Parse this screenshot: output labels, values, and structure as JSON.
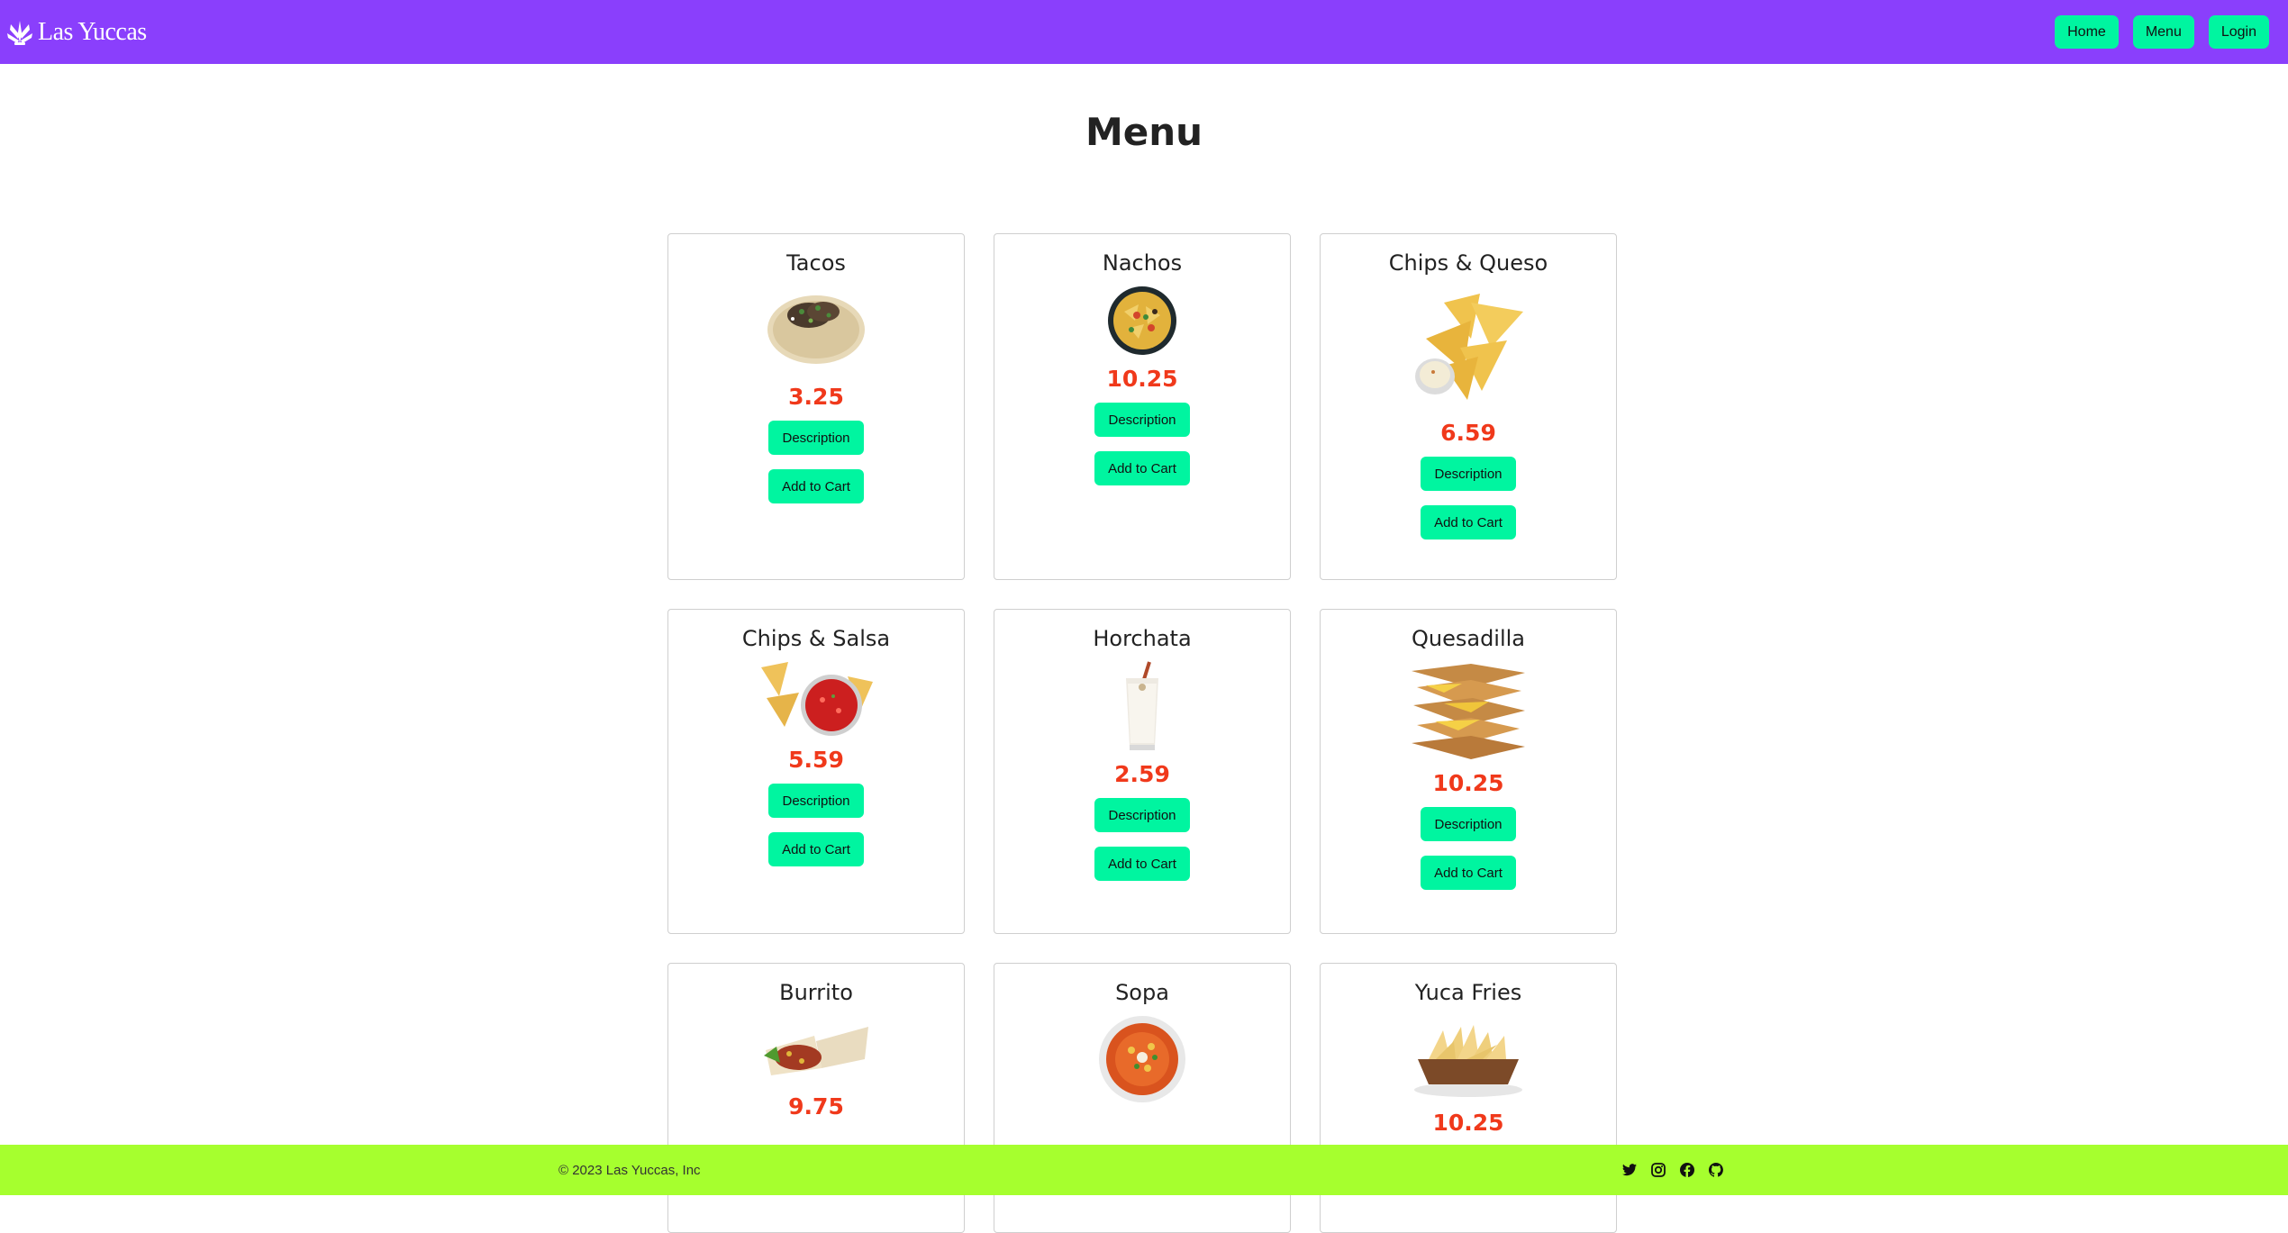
{
  "navbar": {
    "brand": "Las Yuccas",
    "links": [
      "Home",
      "Menu",
      "Login"
    ],
    "bg_color": "#8a3ffc",
    "button_color": "#00f5a0"
  },
  "page_title": "Menu",
  "items": [
    {
      "name": "Tacos",
      "price": "3.25",
      "description_label": "Description",
      "cart_label": "Add to Cart",
      "icon": "tacos-image"
    },
    {
      "name": "Nachos",
      "price": "10.25",
      "description_label": "Description",
      "cart_label": "Add to Cart",
      "icon": "nachos-image"
    },
    {
      "name": "Chips & Queso",
      "price": "6.59",
      "description_label": "Description",
      "cart_label": "Add to Cart",
      "icon": "chips-queso-image"
    },
    {
      "name": "Chips & Salsa",
      "price": "5.59",
      "description_label": "Description",
      "cart_label": "Add to Cart",
      "icon": "chips-salsa-image"
    },
    {
      "name": "Horchata",
      "price": "2.59",
      "description_label": "Description",
      "cart_label": "Add to Cart",
      "icon": "horchata-image"
    },
    {
      "name": "Quesadilla",
      "price": "10.25",
      "description_label": "Description",
      "cart_label": "Add to Cart",
      "icon": "quesadilla-image"
    },
    {
      "name": "Burrito",
      "price": "9.75",
      "icon": "burrito-image"
    },
    {
      "name": "Sopa",
      "icon": "sopa-image"
    },
    {
      "name": "Yuca Fries",
      "price": "10.25",
      "icon": "yuca-fries-image"
    }
  ],
  "price_color": "#f0391b",
  "footer": {
    "copyright": "© 2023 Las Yuccas, Inc",
    "social_icons": [
      "twitter-icon",
      "instagram-icon",
      "facebook-icon",
      "github-icon"
    ],
    "bg_color": "#a6ff2e"
  }
}
